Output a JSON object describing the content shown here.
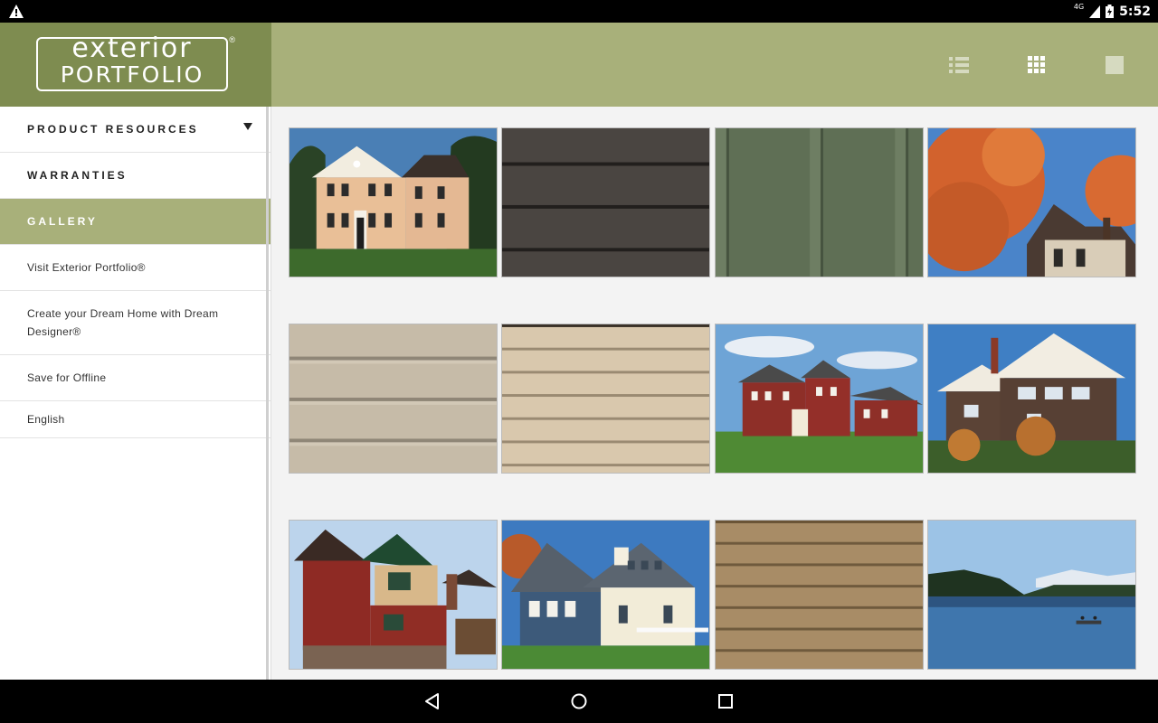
{
  "status_bar": {
    "network": "4G",
    "time": "5:52"
  },
  "brand": {
    "line1": "exterior",
    "line2": "PORTFOLIO",
    "registered": "®"
  },
  "sidebar": {
    "items": [
      {
        "label": "PRODUCT RESOURCES",
        "style": "caps",
        "has_dropdown": true
      },
      {
        "label": "WARRANTIES",
        "style": "caps"
      },
      {
        "label": "GALLERY",
        "style": "caps",
        "active": true
      },
      {
        "label": "Visit Exterior Portfolio®",
        "style": "plain"
      },
      {
        "label": "Create your Dream Home with Dream Designer®",
        "style": "plain"
      },
      {
        "label": "Save for Offline",
        "style": "plain"
      },
      {
        "label": "English",
        "style": "plain"
      }
    ]
  },
  "header": {
    "view_modes": [
      {
        "icon": "list-view-icon",
        "active": false
      },
      {
        "icon": "grid-view-icon",
        "active": true
      },
      {
        "icon": "single-view-icon",
        "active": false
      }
    ]
  },
  "gallery": {
    "tiles": [
      {
        "name": "colonial-house-tan-siding",
        "kind": "house"
      },
      {
        "name": "dark-gray-siding-swatch",
        "kind": "swatch"
      },
      {
        "name": "green-board-batten-swatch",
        "kind": "swatch"
      },
      {
        "name": "autumn-tree-house",
        "kind": "house"
      },
      {
        "name": "beige-siding-swatch",
        "kind": "swatch"
      },
      {
        "name": "light-tan-siding-swatch",
        "kind": "swatch"
      },
      {
        "name": "red-brick-house",
        "kind": "house"
      },
      {
        "name": "craftsman-brown-house",
        "kind": "house"
      },
      {
        "name": "red-cabin-house",
        "kind": "house"
      },
      {
        "name": "blue-cape-cod-house",
        "kind": "house"
      },
      {
        "name": "khaki-siding-swatch",
        "kind": "swatch"
      },
      {
        "name": "lake-scene",
        "kind": "landscape"
      }
    ]
  },
  "colors": {
    "header": "#a8b07a",
    "logo_bg": "#7e8c50",
    "active_nav": "#a8b07a"
  }
}
